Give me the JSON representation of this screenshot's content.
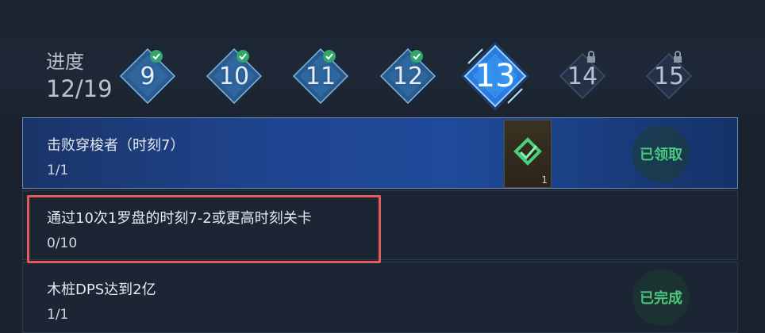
{
  "progress": {
    "label": "进度",
    "count": "12/19"
  },
  "stages": [
    {
      "number": "9",
      "state": "completed",
      "icon": "check-icon"
    },
    {
      "number": "10",
      "state": "completed",
      "icon": "check-icon"
    },
    {
      "number": "11",
      "state": "completed",
      "icon": "check-icon"
    },
    {
      "number": "12",
      "state": "completed",
      "icon": "check-icon"
    },
    {
      "number": "13",
      "state": "current"
    },
    {
      "number": "14",
      "state": "locked",
      "icon": "lock-icon"
    },
    {
      "number": "15",
      "state": "locked",
      "icon": "lock-icon"
    }
  ],
  "tasks": [
    {
      "title": "击败穿梭者（时刻7）",
      "progress": "1/1",
      "reward_qty": "1",
      "status": "已领取"
    },
    {
      "title": "通过10次1罗盘的时刻7-2或更高时刻关卡",
      "progress": "0/10"
    },
    {
      "title": "木桩DPS达到2亿",
      "progress": "1/1",
      "status": "已完成"
    }
  ],
  "colors": {
    "accent": "#3aa8ff",
    "done": "#49c97a",
    "highlight": "#e85a5a"
  }
}
